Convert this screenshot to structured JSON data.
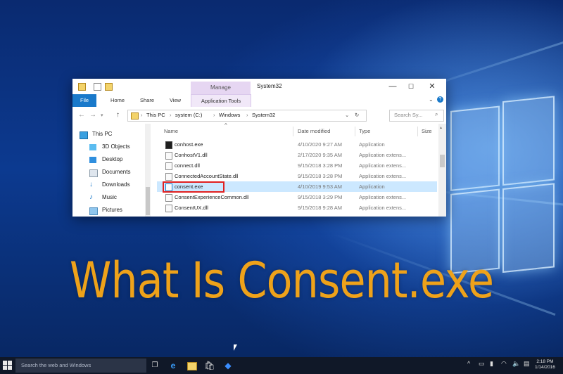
{
  "window": {
    "title": "System32",
    "manage_tab": "Manage",
    "controls": [
      "—",
      "☐",
      "✕"
    ]
  },
  "ribbon": {
    "tabs": [
      "File",
      "Home",
      "Share",
      "View",
      "Application Tools"
    ]
  },
  "address": {
    "crumbs": [
      "This PC",
      "system (C:)",
      "Windows",
      "System32"
    ],
    "search_placeholder": "Search Sy..."
  },
  "nav_pane": {
    "items": [
      {
        "label": "This PC",
        "icon": "computer-icon"
      },
      {
        "label": "3D Objects",
        "icon": "cube-icon"
      },
      {
        "label": "Desktop",
        "icon": "desktop-icon"
      },
      {
        "label": "Documents",
        "icon": "documents-icon"
      },
      {
        "label": "Downloads",
        "icon": "download-icon"
      },
      {
        "label": "Music",
        "icon": "music-icon"
      },
      {
        "label": "Pictures",
        "icon": "pictures-icon"
      }
    ]
  },
  "files": {
    "columns": [
      "Name",
      "Date modified",
      "Type",
      "Size"
    ],
    "rows": [
      {
        "name": "conhost.exe",
        "date": "4/10/2020 9:27 AM",
        "type": "Application",
        "icon": "exe"
      },
      {
        "name": "ConhostV1.dll",
        "date": "2/17/2020 9:35 AM",
        "type": "Application extens...",
        "icon": "dll"
      },
      {
        "name": "connect.dll",
        "date": "9/15/2018 3:28 PM",
        "type": "Application extens...",
        "icon": "dll"
      },
      {
        "name": "ConnectedAccountState.dll",
        "date": "9/15/2018 3:28 PM",
        "type": "Application extens...",
        "icon": "dll"
      },
      {
        "name": "consent.exe",
        "date": "4/10/2019 9:53 AM",
        "type": "Application",
        "icon": "exe"
      },
      {
        "name": "ConsentExperienceCommon.dll",
        "date": "9/15/2018 3:29 PM",
        "type": "Application extens...",
        "icon": "dll"
      },
      {
        "name": "ConsentUX.dll",
        "date": "9/15/2018 9:28 AM",
        "type": "Application extens...",
        "icon": "dll"
      }
    ]
  },
  "headline": "What Is Consent.exe",
  "taskbar": {
    "search_placeholder": "Search the web and Windows",
    "time": "2:18 PM",
    "date": "1/14/2016"
  },
  "colors": {
    "accent": "#1979ca",
    "headline": "#eea21a",
    "highlight": "#e02020",
    "selection": "#cce8ff"
  }
}
